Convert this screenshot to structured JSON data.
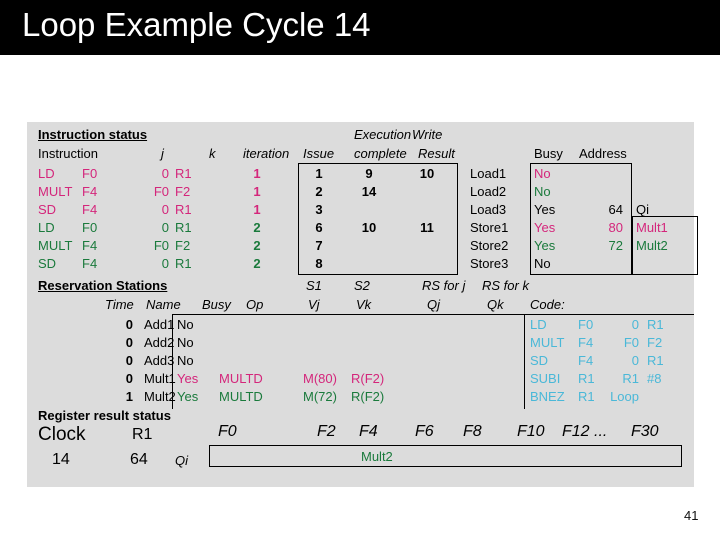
{
  "slide": {
    "title": "Loop Example Cycle 14",
    "page_number": "41",
    "colors": {
      "title_bar": "#000000",
      "panel": "#dcdcdc",
      "iteration1": "#d4267b",
      "iteration2": "#1a7a3c",
      "code": "#4ab8d8"
    }
  },
  "instruction_status": {
    "section_label": "Instruction status",
    "headers": {
      "instruction": "Instruction",
      "j": "j",
      "k": "k",
      "iteration": "iteration",
      "exec_group": "Execution",
      "write_group": "Write",
      "issue": "Issue",
      "exec_complete": "complete",
      "write_result": "Result"
    },
    "rows": [
      {
        "op": "LD",
        "dest": "F0",
        "j": "0",
        "k": "R1",
        "iteration": "1",
        "issue": "1",
        "exec": "9",
        "write": "10",
        "color": "iteration1"
      },
      {
        "op": "MULT",
        "dest": "F4",
        "j": "F0",
        "k": "F2",
        "iteration": "1",
        "issue": "2",
        "exec": "14",
        "write": "",
        "color": "iteration1"
      },
      {
        "op": "SD",
        "dest": "F4",
        "j": "0",
        "k": "R1",
        "iteration": "1",
        "issue": "3",
        "exec": "",
        "write": "",
        "color": "iteration1"
      },
      {
        "op": "LD",
        "dest": "F0",
        "j": "0",
        "k": "R1",
        "iteration": "2",
        "issue": "6",
        "exec": "10",
        "write": "11",
        "color": "iteration2"
      },
      {
        "op": "MULT",
        "dest": "F4",
        "j": "F0",
        "k": "F2",
        "iteration": "2",
        "issue": "7",
        "exec": "",
        "write": "",
        "color": "iteration2"
      },
      {
        "op": "SD",
        "dest": "F4",
        "j": "0",
        "k": "R1",
        "iteration": "2",
        "issue": "8",
        "exec": "",
        "write": "",
        "color": "iteration2"
      }
    ]
  },
  "load_store_units": {
    "headers": {
      "busy": "Busy",
      "address": "Address",
      "qi": "Qi"
    },
    "rows": [
      {
        "name": "Load1",
        "busy": "No",
        "address": "",
        "qi": "",
        "color": "iteration1"
      },
      {
        "name": "Load2",
        "busy": "No",
        "address": "",
        "qi": "",
        "color": "iteration2"
      },
      {
        "name": "Load3",
        "busy": "Yes",
        "address": "64",
        "qi": "",
        "color": "black"
      },
      {
        "name": "Store1",
        "busy": "Yes",
        "address": "80",
        "qi": "Mult1",
        "color": "iteration1"
      },
      {
        "name": "Store2",
        "busy": "Yes",
        "address": "72",
        "qi": "Mult2",
        "color": "iteration2"
      },
      {
        "name": "Store3",
        "busy": "No",
        "address": "",
        "qi": "",
        "color": "black"
      }
    ]
  },
  "reservation_stations": {
    "section_label": "Reservation Stations",
    "headers": {
      "time": "Time",
      "name": "Name",
      "busy": "Busy",
      "op": "Op",
      "s1": "S1",
      "s2": "S2",
      "rs_for_j": "RS for j",
      "rs_for_k": "RS for k",
      "vj": "Vj",
      "vk": "Vk",
      "qj": "Qj",
      "qk": "Qk"
    },
    "rows": [
      {
        "time": "0",
        "name": "Add1",
        "busy": "No",
        "op": "",
        "vj": "",
        "vk": "",
        "qj": "",
        "qk": "",
        "color": "black"
      },
      {
        "time": "0",
        "name": "Add2",
        "busy": "No",
        "op": "",
        "vj": "",
        "vk": "",
        "qj": "",
        "qk": "",
        "color": "black"
      },
      {
        "time": "0",
        "name": "Add3",
        "busy": "No",
        "op": "",
        "vj": "",
        "vk": "",
        "qj": "",
        "qk": "",
        "color": "black"
      },
      {
        "time": "0",
        "name": "Mult1",
        "busy": "Yes",
        "op": "MULTD",
        "vj": "M(80)",
        "vk": "R(F2)",
        "qj": "",
        "qk": "",
        "color": "iteration1"
      },
      {
        "time": "1",
        "name": "Mult2",
        "busy": "Yes",
        "op": "MULTD",
        "vj": "M(72)",
        "vk": "R(F2)",
        "qj": "",
        "qk": "",
        "color": "iteration2"
      }
    ]
  },
  "code": {
    "label": "Code:",
    "lines": [
      {
        "op": "LD",
        "a": "F0",
        "b": "0",
        "c": "R1"
      },
      {
        "op": "MULT",
        "a": "F4",
        "b": "F0",
        "c": "F2"
      },
      {
        "op": "SD",
        "a": "F4",
        "b": "0",
        "c": "R1"
      },
      {
        "op": "SUBI",
        "a": "R1",
        "b": "R1",
        "c": "#8"
      },
      {
        "op": "BNEZ",
        "a": "R1",
        "b": "Loop",
        "c": ""
      }
    ]
  },
  "register_result_status": {
    "section_label": "Register result status",
    "clock_label": "Clock",
    "clock_value": "14",
    "r1_label": "R1",
    "r1_value": "64",
    "qi_label": "Qi",
    "registers": [
      "F0",
      "F2",
      "F4",
      "F6",
      "F8",
      "F10",
      "F12 ...",
      "F30"
    ],
    "entries": [
      {
        "register": "F4",
        "value": "Mult2",
        "color": "iteration2"
      }
    ]
  }
}
